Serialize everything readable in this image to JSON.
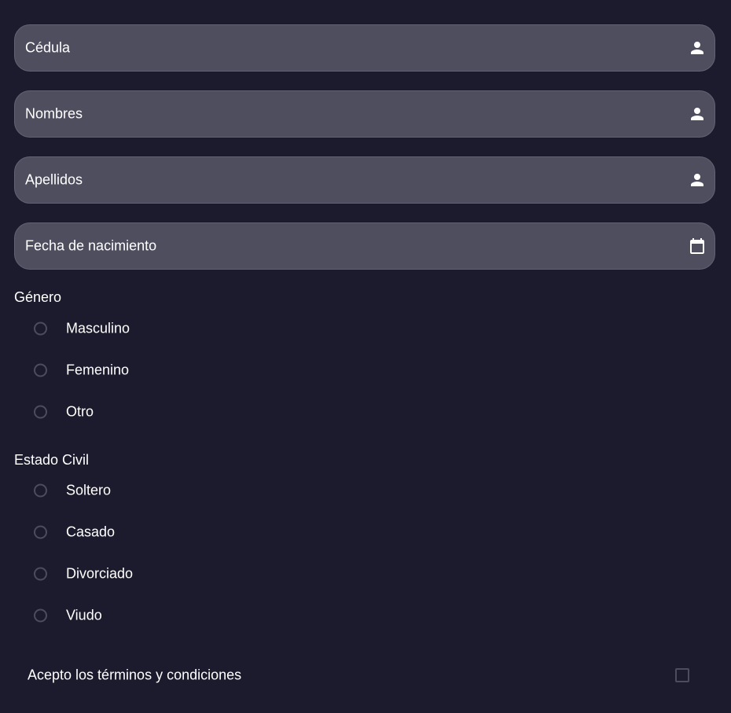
{
  "form": {
    "fields": [
      {
        "label": "Cédula",
        "icon": "person-icon"
      },
      {
        "label": "Nombres",
        "icon": "person-icon"
      },
      {
        "label": "Apellidos",
        "icon": "person-icon"
      },
      {
        "label": "Fecha de nacimiento",
        "icon": "calendar-icon"
      }
    ],
    "genero": {
      "title": "Género",
      "options": [
        "Masculino",
        "Femenino",
        "Otro"
      ]
    },
    "estado_civil": {
      "title": "Estado Civil",
      "options": [
        "Soltero",
        "Casado",
        "Divorciado",
        "Viudo"
      ]
    },
    "terms": {
      "label": "Acepto los términos y condiciones",
      "checked": false
    }
  },
  "colors": {
    "background": "#1b1b2d",
    "field_fill": "#4f4e5f",
    "control_border": "#4d4c5c",
    "text": "#ffffff"
  }
}
